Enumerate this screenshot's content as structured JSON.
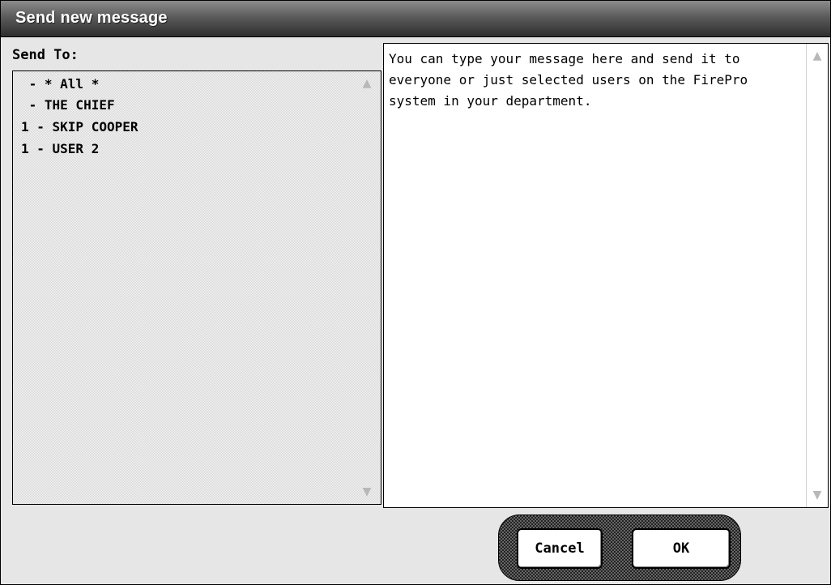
{
  "window": {
    "title": "Send new message"
  },
  "send_to": {
    "label": "Send To:",
    "recipients": [
      {
        "text": " - * All *"
      },
      {
        "text": " - THE CHIEF"
      },
      {
        "text": "1 - SKIP COOPER"
      },
      {
        "text": "1 - USER 2"
      }
    ]
  },
  "message": {
    "body": "You can type your message here and send it to everyone or just selected users on the FirePro system in your department."
  },
  "buttons": {
    "cancel_label": "Cancel",
    "ok_label": "OK"
  },
  "icons": {
    "scroll_up": "scroll-up-arrow-icon",
    "scroll_down": "scroll-down-arrow-icon"
  }
}
